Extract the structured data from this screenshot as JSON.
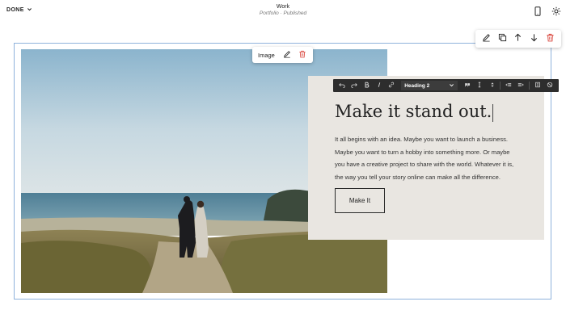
{
  "topbar": {
    "done_label": "DONE",
    "page_title": "Work",
    "page_subtitle": "Portfolio · Published",
    "icons": [
      "chevron-down-icon",
      "mobile-icon",
      "settings-icon"
    ]
  },
  "section_toolbar": {
    "icons": [
      "edit-icon",
      "duplicate-icon",
      "move-up-icon",
      "move-down-icon",
      "delete-icon"
    ],
    "delete_color": "#d9443b"
  },
  "image_block": {
    "toolbar_label": "Image",
    "icons": [
      "edit-icon",
      "delete-icon"
    ]
  },
  "text_editor": {
    "block_style": "Heading 2",
    "tools": [
      "undo-icon",
      "redo-icon",
      "bold-icon",
      "italic-icon",
      "link-icon",
      "quote-icon",
      "more-icon",
      "sort-icon",
      "outdent-icon",
      "indent-icon",
      "clear-format-icon",
      "unlink-icon"
    ]
  },
  "content": {
    "heading": "Make it stand out.",
    "body": "It all begins with an idea. Maybe you want to launch a business. Maybe you want to turn a hobby into something more. Or maybe you have a creative project to share with the world. Whatever it is, the way you tell your story online can make all the difference.",
    "button_label": "Make It"
  },
  "colors": {
    "card_background": "#e9e6e1",
    "section_outline": "#8fb2dc",
    "toolbar_dark": "#2d2d2d"
  }
}
